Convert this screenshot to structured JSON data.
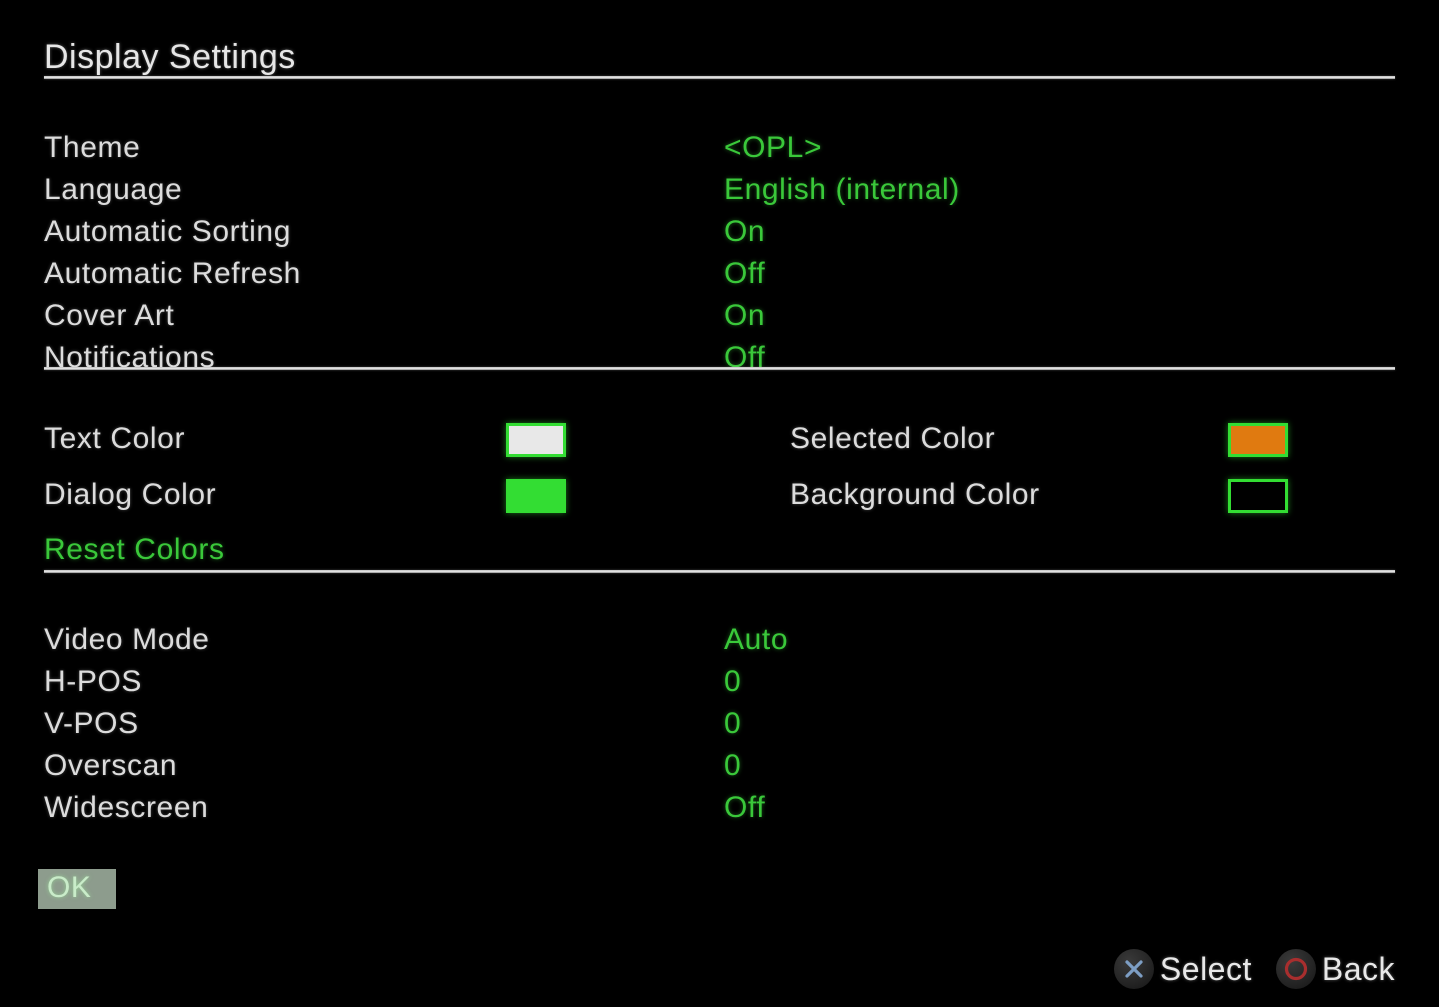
{
  "page": {
    "title": "Display Settings",
    "background_color": "#000000",
    "label_color": "#dcdcdc",
    "value_color": "#3ac83a"
  },
  "general_settings": [
    {
      "label": "Theme",
      "value": "<OPL>"
    },
    {
      "label": "Language",
      "value": "English (internal)"
    },
    {
      "label": "Automatic Sorting",
      "value": "On"
    },
    {
      "label": "Automatic Refresh",
      "value": "Off"
    },
    {
      "label": "Cover Art",
      "value": "On"
    },
    {
      "label": "Notifications",
      "value": "Off"
    }
  ],
  "color_settings": {
    "left": [
      {
        "label": "Text Color",
        "swatch_fill": "#e8e8e8",
        "swatch_border": "#33dd33"
      },
      {
        "label": "Dialog Color",
        "swatch_fill": "#33dd33",
        "swatch_border": "#33dd33"
      }
    ],
    "right": [
      {
        "label": "Selected Color",
        "swatch_fill": "#e07a10",
        "swatch_border": "#33dd33"
      },
      {
        "label": "Background Color",
        "swatch_fill": "#000000",
        "swatch_border": "#33dd33"
      }
    ],
    "reset_label": "Reset Colors"
  },
  "video_settings": [
    {
      "label": "Video Mode",
      "value": "Auto"
    },
    {
      "label": "H-POS",
      "value": "0"
    },
    {
      "label": "V-POS",
      "value": "0"
    },
    {
      "label": "Overscan",
      "value": "0"
    },
    {
      "label": "Widescreen",
      "value": "Off"
    }
  ],
  "ok_button": {
    "label": "OK",
    "background_color": "#8d9c8d",
    "text_color": "#c9ecc9"
  },
  "hints": [
    {
      "icon": "cross-button-icon",
      "label": "Select",
      "icon_color": "#6f8fb5"
    },
    {
      "icon": "circle-button-icon",
      "label": "Back",
      "icon_color": "#a02a2a"
    }
  ]
}
